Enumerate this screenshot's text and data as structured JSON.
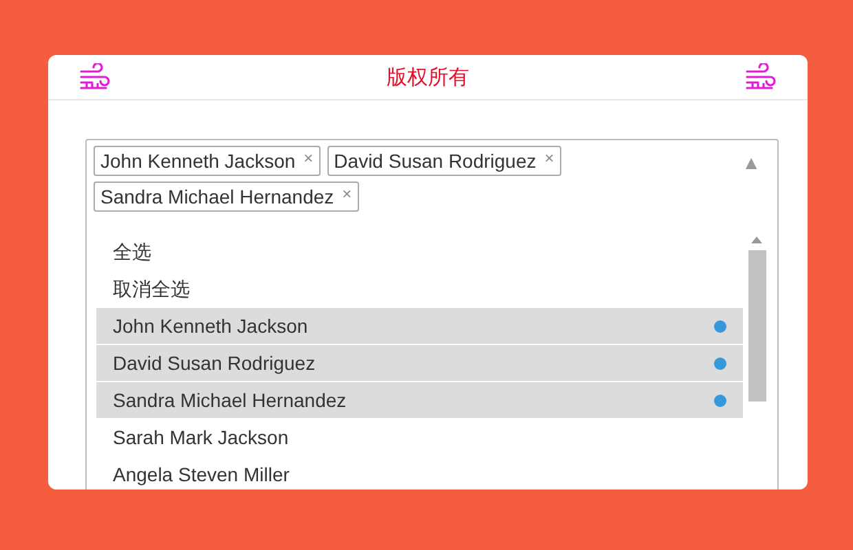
{
  "header": {
    "title": "版权所有"
  },
  "select": {
    "tags": [
      {
        "label": "John Kenneth Jackson",
        "remove": "×"
      },
      {
        "label": "David Susan Rodriguez",
        "remove": "×"
      },
      {
        "label": "Sandra Michael Hernandez",
        "remove": "×"
      }
    ],
    "toggle": "▲",
    "options": [
      {
        "kind": "action",
        "label": "全选"
      },
      {
        "kind": "action",
        "label": "取消全选"
      },
      {
        "kind": "option",
        "label": "John Kenneth Jackson",
        "selected": true
      },
      {
        "kind": "option",
        "label": "David Susan Rodriguez",
        "selected": true
      },
      {
        "kind": "option",
        "label": "Sandra Michael Hernandez",
        "selected": true
      },
      {
        "kind": "option",
        "label": "Sarah Mark Jackson",
        "selected": false
      },
      {
        "kind": "option",
        "label": "Angela Steven Miller",
        "selected": false
      }
    ]
  }
}
